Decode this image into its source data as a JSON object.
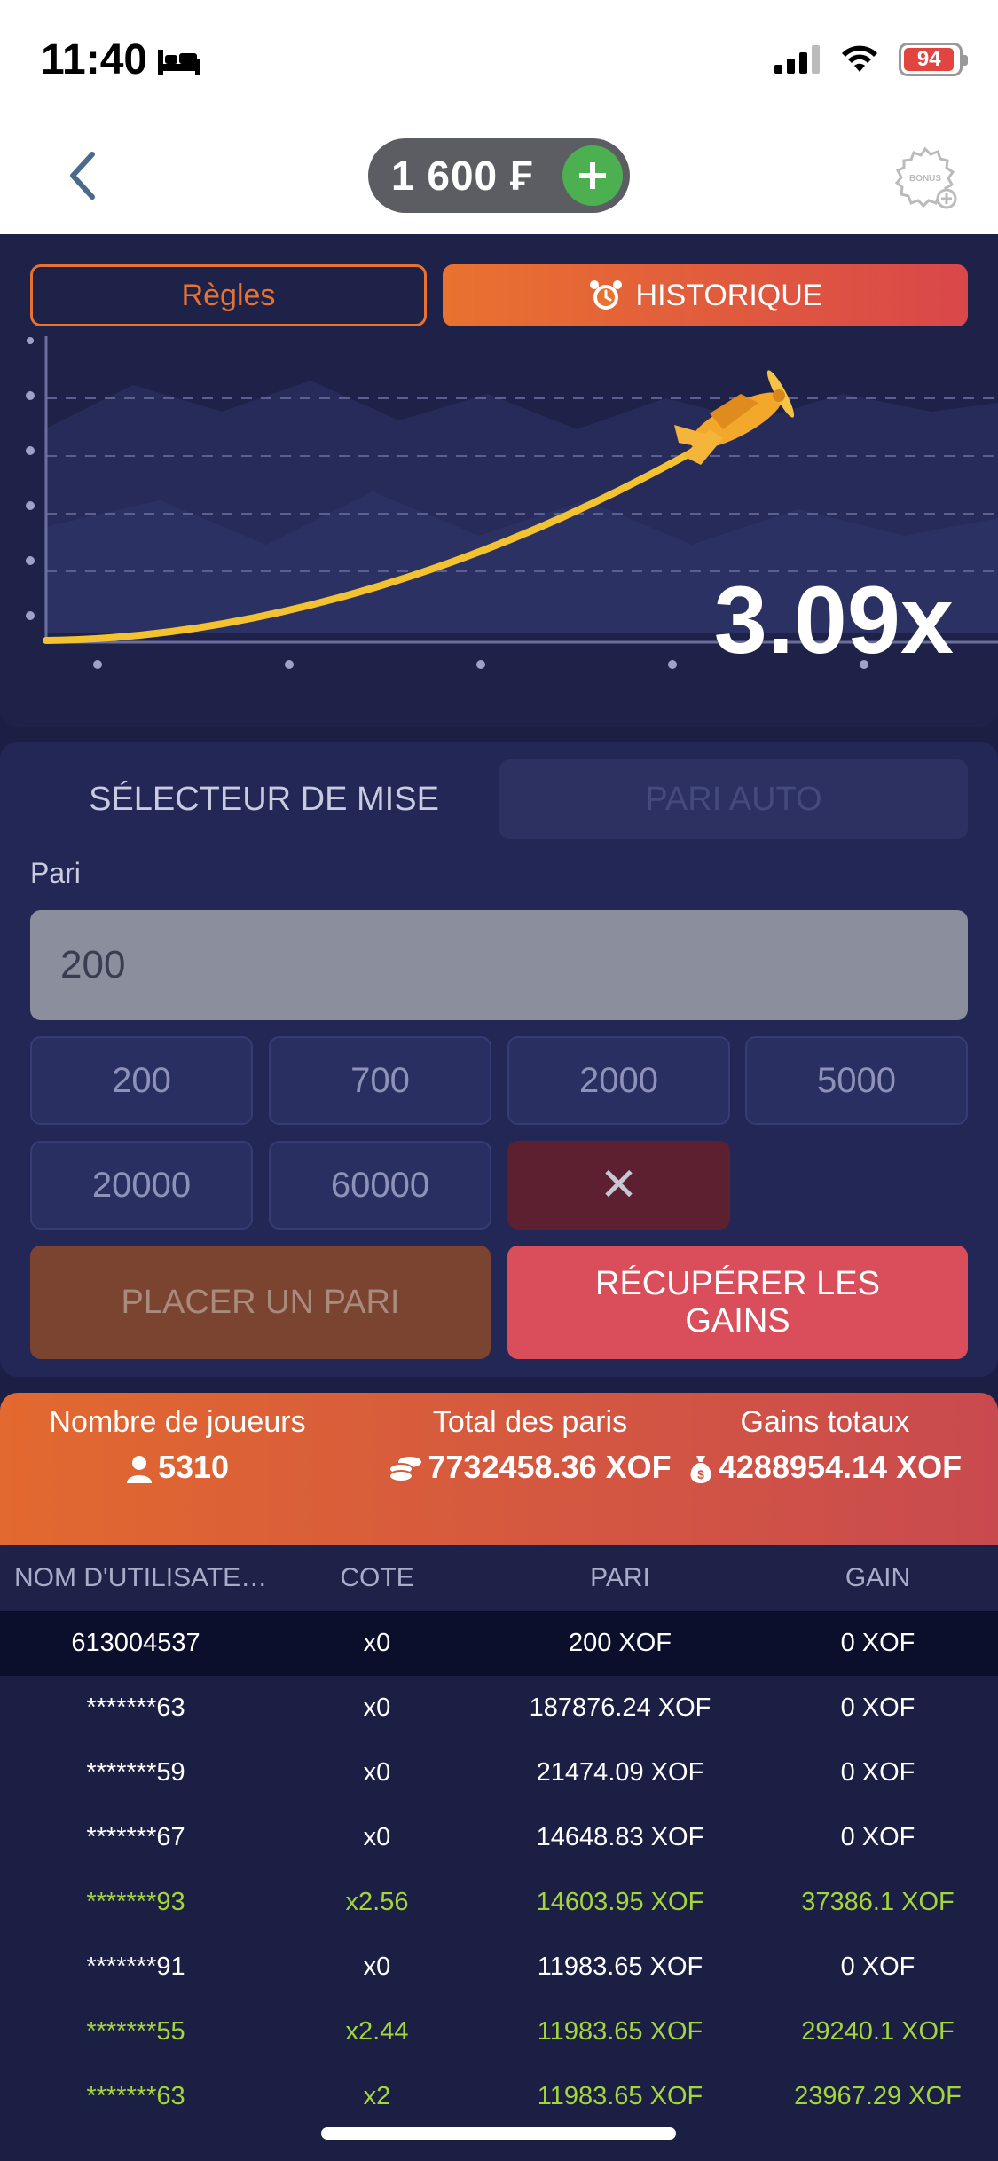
{
  "status_bar": {
    "time": "11:40",
    "battery": "94"
  },
  "header": {
    "balance": "1 600 ₣",
    "bonus_label": "BONUS"
  },
  "tabs": {
    "rules": "Règles",
    "history": "HISTORIQUE"
  },
  "game": {
    "multiplier": "3.09x"
  },
  "bet_panel": {
    "tab_selector": "SÉLECTEUR DE MISE",
    "tab_auto": "PARI AUTO",
    "pari_label": "Pari",
    "pari_value": "200",
    "chips": [
      "200",
      "700",
      "2000",
      "5000",
      "20000",
      "60000"
    ],
    "clear_symbol": "✕",
    "place_bet": "PLACER UN PARI",
    "cashout": "RÉCUPÉRER LES GAINS"
  },
  "stats": {
    "players_title": "Nombre de joueurs",
    "players_value": "5310",
    "bets_title": "Total des paris",
    "bets_value": "7732458.36 XOF",
    "wins_title": "Gains totaux",
    "wins_value": "4288954.14 XOF"
  },
  "table": {
    "headers": [
      "NOM D'UTILISATEUR",
      "COTE",
      "PARI",
      "GAIN"
    ],
    "rows": [
      {
        "user": "613004537",
        "odds": "x0",
        "bet": "200 XOF",
        "gain": "0 XOF",
        "win": false
      },
      {
        "user": "*******63",
        "odds": "x0",
        "bet": "187876.24 XOF",
        "gain": "0 XOF",
        "win": false
      },
      {
        "user": "*******59",
        "odds": "x0",
        "bet": "21474.09 XOF",
        "gain": "0 XOF",
        "win": false
      },
      {
        "user": "*******67",
        "odds": "x0",
        "bet": "14648.83 XOF",
        "gain": "0 XOF",
        "win": false
      },
      {
        "user": "*******93",
        "odds": "x2.56",
        "bet": "14603.95 XOF",
        "gain": "37386.1 XOF",
        "win": true
      },
      {
        "user": "*******91",
        "odds": "x0",
        "bet": "11983.65 XOF",
        "gain": "0 XOF",
        "win": false
      },
      {
        "user": "*******55",
        "odds": "x2.44",
        "bet": "11983.65 XOF",
        "gain": "29240.1 XOF",
        "win": true
      },
      {
        "user": "*******63",
        "odds": "x2",
        "bet": "11983.65 XOF",
        "gain": "23967.29 XOF",
        "win": true
      }
    ]
  },
  "colors": {
    "accent_orange": "#e9722f",
    "accent_red": "#d94e5a",
    "win_green": "#a4d53a",
    "panel_bg": "#1e2248"
  }
}
